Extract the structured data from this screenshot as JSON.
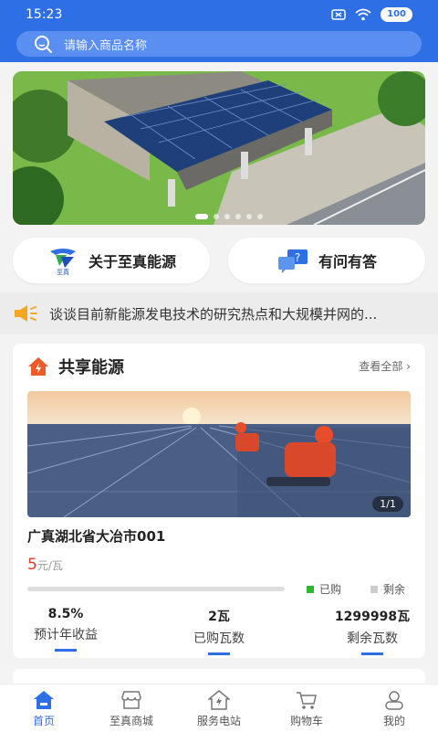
{
  "status_bar": {
    "time": "15:23",
    "battery": "100"
  },
  "search": {
    "placeholder": "请输入商品名称"
  },
  "banner": {
    "dots": 6
  },
  "quick_links": [
    {
      "label": "关于至真能源",
      "icon": "zhizhen-logo-icon",
      "logo_text": "至真"
    },
    {
      "label": "有问有答",
      "icon": "qa-icon"
    }
  ],
  "notice": {
    "text": "谈谈目前新能源发电技术的研究热点和大规模并网的..."
  },
  "shared_energy": {
    "title": "共享能源",
    "more_label": "查看全部",
    "image_counter": "1/1",
    "item_name": "广真湖北省大冶市001",
    "price_value": "5",
    "price_unit": "元/瓦",
    "progress_fraction": 0.0,
    "legend": {
      "bought": "已购",
      "remaining": "剩余"
    },
    "stats": [
      {
        "value": "8.5%",
        "label": "预计年收益"
      },
      {
        "value": "2瓦",
        "label": "已购瓦数"
      },
      {
        "value": "1299998瓦",
        "label": "剩余瓦数"
      }
    ]
  },
  "colors": {
    "primary": "#2f6fe6",
    "price": "#e53935",
    "bought": "#2eb82e",
    "remaining": "#cccccc"
  },
  "tabbar": [
    {
      "label": "首页",
      "icon": "home-icon",
      "active": true
    },
    {
      "label": "至真商城",
      "icon": "shop-icon",
      "active": false
    },
    {
      "label": "服务电站",
      "icon": "power-station-icon",
      "active": false
    },
    {
      "label": "购物车",
      "icon": "cart-icon",
      "active": false
    },
    {
      "label": "我的",
      "icon": "profile-icon",
      "active": false
    }
  ]
}
